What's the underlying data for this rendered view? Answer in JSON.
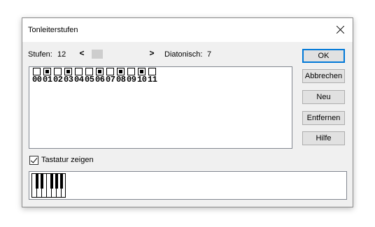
{
  "window": {
    "title": "Tonleiterstufen"
  },
  "stufen": {
    "label": "Stufen:",
    "value": "12"
  },
  "scroll": {
    "left": "<",
    "right": ">"
  },
  "diatonisch": {
    "label": "Diatonisch:",
    "value": "7"
  },
  "steps": [
    {
      "num": "00",
      "diatonic": false
    },
    {
      "num": "01",
      "diatonic": true
    },
    {
      "num": "02",
      "diatonic": false
    },
    {
      "num": "03",
      "diatonic": true
    },
    {
      "num": "04",
      "diatonic": false
    },
    {
      "num": "05",
      "diatonic": false
    },
    {
      "num": "06",
      "diatonic": true
    },
    {
      "num": "07",
      "diatonic": false
    },
    {
      "num": "08",
      "diatonic": true
    },
    {
      "num": "09",
      "diatonic": false
    },
    {
      "num": "10",
      "diatonic": true
    },
    {
      "num": "11",
      "diatonic": false
    }
  ],
  "buttons": {
    "ok": "OK",
    "abbrechen": "Abbrechen",
    "neu": "Neu",
    "entfernen": "Entfernen",
    "hilfe": "Hilfe"
  },
  "checkbox": {
    "label": "Tastatur zeigen",
    "checked": true
  },
  "colors": {
    "accent": "#0078d7"
  }
}
